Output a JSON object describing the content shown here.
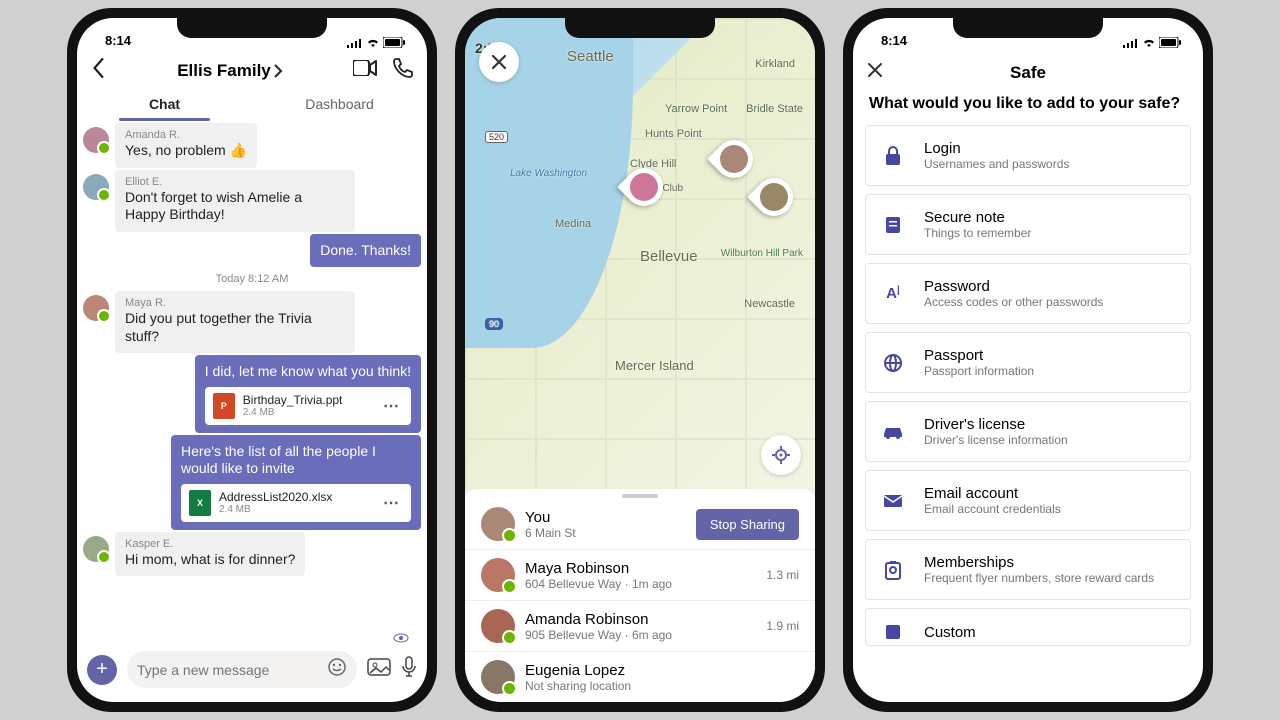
{
  "status": {
    "time": "8:14"
  },
  "chat": {
    "header_title": "Ellis Family",
    "tabs": {
      "chat": "Chat",
      "dashboard": "Dashboard"
    },
    "messages": [
      {
        "sender": "Amanda R.",
        "text": "Yes, no problem 👍"
      },
      {
        "sender": "Elliot E.",
        "text": "Don't forget to wish Amelie a Happy Birthday!"
      },
      {
        "text": "Done. Thanks!"
      }
    ],
    "day_sep": "Today 8:12 AM",
    "maya": {
      "sender": "Maya R.",
      "text": "Did you put together the Trivia stuff?"
    },
    "me1": "I did, let me know what you think!",
    "attach1": {
      "name": "Birthday_Trivia.ppt",
      "size": "2.4 MB"
    },
    "me2": "Here's the list of all the people I would like to invite",
    "attach2": {
      "name": "AddressList2020.xlsx",
      "size": "2.4 MB"
    },
    "kasper": {
      "sender": "Kasper E.",
      "text": "Hi mom, what is for dinner?"
    },
    "compose_placeholder": "Type a new message"
  },
  "map": {
    "labels": {
      "seattle": "Seattle",
      "bellevue": "Bellevue",
      "mercer": "Mercer Island",
      "kirkland": "Kirkland",
      "medina": "Medina",
      "clyde": "Clyde Hill",
      "hunts": "Hunts Point",
      "yarrow": "Yarrow Point",
      "bridle": "Bridle State",
      "wilburton": "Wilburton Hill Park",
      "newcastle": "Newcastle",
      "lakewa": "Lake Washington",
      "club": "ntry Club",
      "shield1": "520",
      "shield2": "90",
      "time": "2:55"
    },
    "stop_label": "Stop Sharing",
    "people": [
      {
        "name": "You",
        "sub": "6 Main St",
        "dist": ""
      },
      {
        "name": "Maya Robinson",
        "sub": "604 Bellevue Way · 1m ago",
        "dist": "1.3 mi"
      },
      {
        "name": "Amanda Robinson",
        "sub": "905 Bellevue Way · 6m ago",
        "dist": "1.9 mi"
      },
      {
        "name": "Eugenia Lopez",
        "sub": "Not sharing location",
        "dist": ""
      }
    ]
  },
  "safe": {
    "title": "Safe",
    "prompt": "What would you like to add to your safe?",
    "items": [
      {
        "title": "Login",
        "sub": "Usernames and passwords",
        "icon": "lock"
      },
      {
        "title": "Secure note",
        "sub": "Things to remember",
        "icon": "note"
      },
      {
        "title": "Password",
        "sub": "Access codes or other passwords",
        "icon": "letters"
      },
      {
        "title": "Passport",
        "sub": "Passport information",
        "icon": "globe"
      },
      {
        "title": "Driver's license",
        "sub": "Driver's license information",
        "icon": "car"
      },
      {
        "title": "Email account",
        "sub": "Email account credentials",
        "icon": "mail"
      },
      {
        "title": "Memberships",
        "sub": "Frequent flyer numbers, store reward cards",
        "icon": "badge"
      },
      {
        "title": "Custom",
        "sub": "",
        "icon": "custom"
      }
    ]
  }
}
